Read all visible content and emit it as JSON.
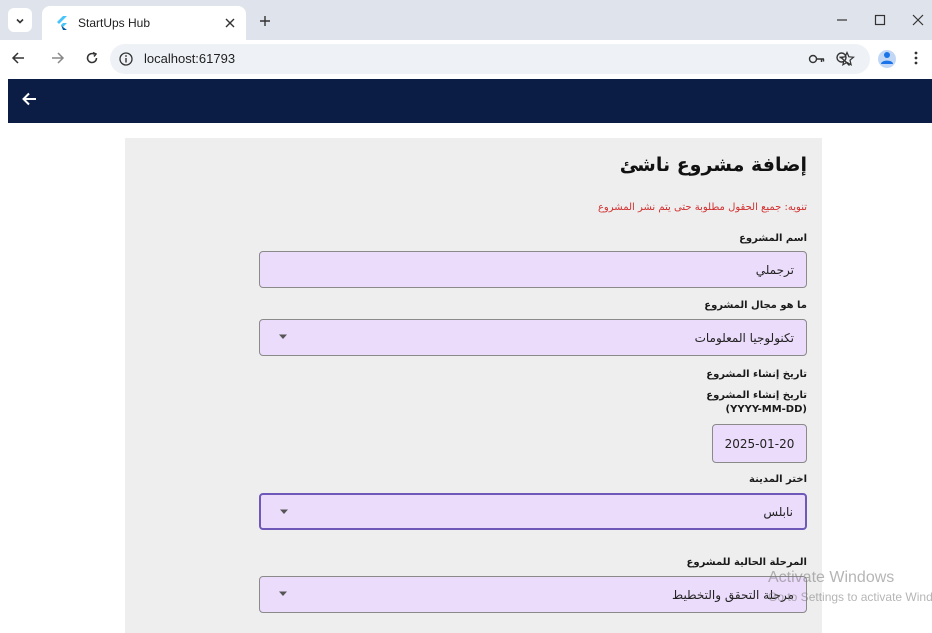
{
  "browser": {
    "tab_title": "StartUps Hub",
    "url": "localhost:61793"
  },
  "page": {
    "title": "إضافة مشروع ناشئ",
    "notice": "تنويه: جميع الحقول مطلوبة حتى يتم نشر المشروع",
    "project_name": {
      "label": "اسم المشروع",
      "value": "ترجملي"
    },
    "project_field": {
      "label": "ما هو مجال المشروع",
      "value": "تكنولوجيا المعلومات"
    },
    "creation_date": {
      "section_label": "تاريخ إنشاء المشروع",
      "input_label": "تاريخ إنشاء المشروع",
      "format_label": "(YYYY-MM-DD)",
      "value": "2025-01-20"
    },
    "city": {
      "label": "اختر المدينة",
      "value": "نابلس"
    },
    "stage": {
      "label": "المرحلة الحالية للمشروع",
      "value": "مرحلة التحقق والتخطيط"
    }
  },
  "watermark": {
    "title": "Activate Windows",
    "subtitle": "Go to Settings to activate Windows."
  },
  "colors": {
    "appbar": "#0b1d45",
    "field_fill": "#ebdcfb",
    "notice": "#d32f2f",
    "focus_border": "#6e59b8"
  }
}
